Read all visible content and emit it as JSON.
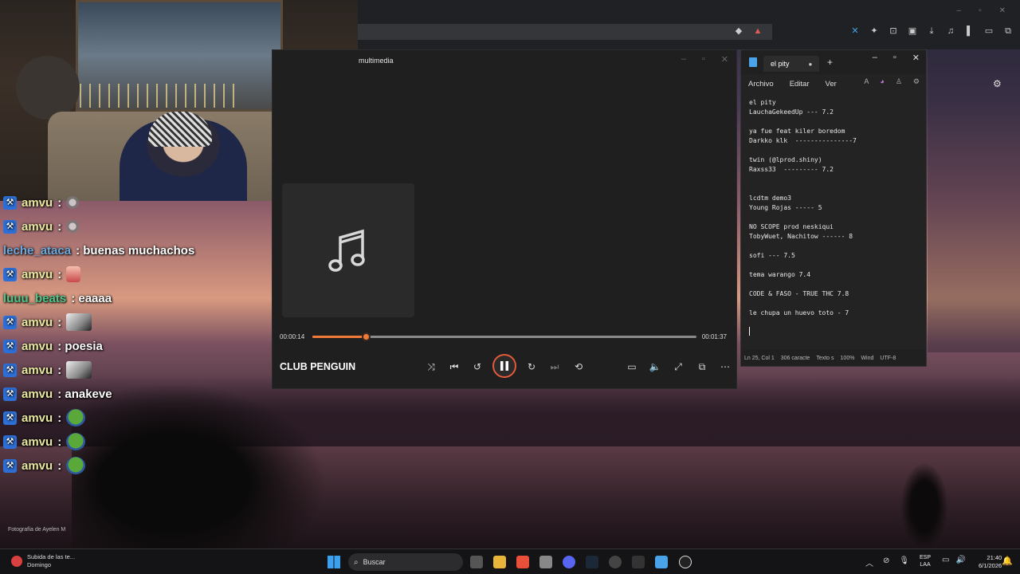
{
  "desktop": {
    "photo_credit": "Fotografía de Ayelen M"
  },
  "chat": {
    "messages": [
      {
        "user": "amvu",
        "text": ":",
        "emote": "small"
      },
      {
        "user": "amvu",
        "text": ":",
        "emote": "small"
      },
      {
        "user": "leche_ataca",
        "text": ": buenas muchachos",
        "emote": ""
      },
      {
        "user": "amvu",
        "text": ":",
        "emote": "char"
      },
      {
        "user": "luuu_beats",
        "text": ": eaaaa",
        "emote": ""
      },
      {
        "user": "amvu",
        "text": ":",
        "emote": "square"
      },
      {
        "user": "amvu",
        "text": ": poesia",
        "emote": ""
      },
      {
        "user": "amvu",
        "text": ":",
        "emote": "square"
      },
      {
        "user": "amvu",
        "text": ": anakeve",
        "emote": ""
      },
      {
        "user": "amvu",
        "text": ":",
        "emote": "frog"
      },
      {
        "user": "amvu",
        "text": ":",
        "emote": "frog"
      },
      {
        "user": "amvu",
        "text": ":",
        "emote": "frog"
      }
    ]
  },
  "player": {
    "title": "multimedia",
    "current_time": "00:00:14",
    "total_time": "00:01:37",
    "progress": 0.138,
    "track_name": "CLUB PENGUIN",
    "accent": "#f07a3a"
  },
  "notepad": {
    "tab_title": "el pity",
    "menu": [
      "Archivo",
      "Editar",
      "Ver"
    ],
    "lines": [
      "el pity",
      "LauchaGekeedUp --- 7.2",
      "",
      "ya fue feat kiler boredom",
      "Darkko klk  ---------------7",
      "",
      "twin (@lprod.shiny)",
      "Raxss33  --------- 7.2",
      "",
      "",
      "lcdtm demo3",
      "Young Rojas ----- 5",
      "",
      "NO SCOPE prod neskiqui",
      "TobyWuet, Nachitow ------ 8",
      "",
      "sofi --- 7.5",
      "",
      "tema warango 7.4",
      "",
      "CODE & FASO - TRUE THC 7.8",
      "",
      "le chupa un huevo toto - 7"
    ],
    "status": {
      "position": "Ln 25, Col 1",
      "chars": "306 caracte",
      "mode": "Texto s",
      "zoom": "100%",
      "eol": "Wind",
      "encoding": "UTF-8"
    }
  },
  "taskbar": {
    "notification_title": "Subida de las te...",
    "notification_sub": "Domingo",
    "search_label": "Buscar",
    "lang_top": "ESP",
    "lang_bottom": "LAA",
    "time": "21:40",
    "date": "6/1/2026"
  }
}
